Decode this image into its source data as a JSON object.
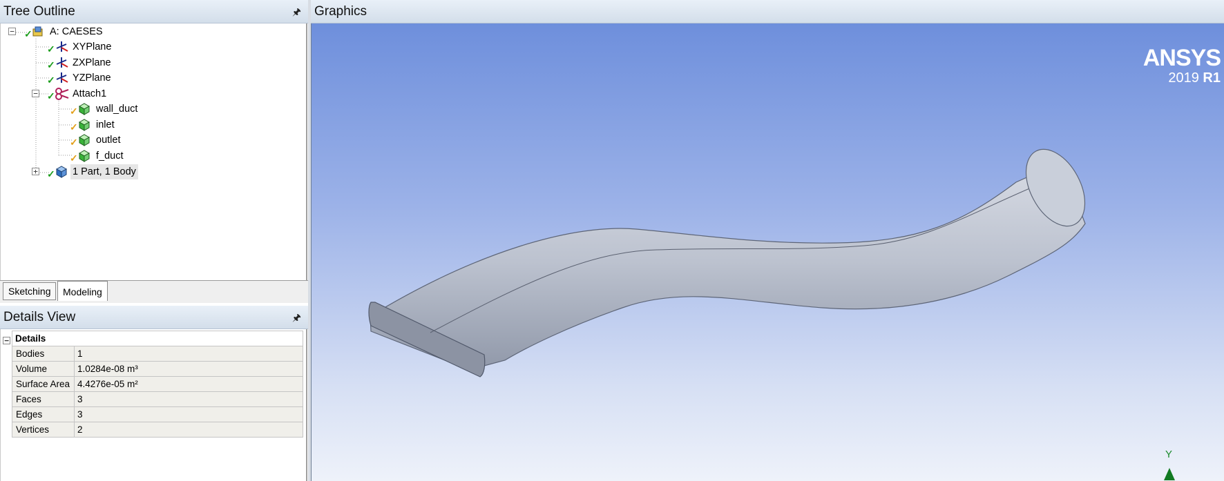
{
  "tree_outline": {
    "title": "Tree Outline",
    "items": [
      {
        "label": "A: CAESES",
        "icon": "geometry-root-icon"
      },
      {
        "label": "XYPlane",
        "icon": "plane-icon"
      },
      {
        "label": "ZXPlane",
        "icon": "plane-icon"
      },
      {
        "label": "YZPlane",
        "icon": "plane-icon"
      },
      {
        "label": "Attach1",
        "icon": "attach-icon"
      },
      {
        "label": "wall_duct",
        "icon": "named-selection-icon"
      },
      {
        "label": "inlet",
        "icon": "named-selection-icon"
      },
      {
        "label": "outlet",
        "icon": "named-selection-icon"
      },
      {
        "label": "f_duct",
        "icon": "named-selection-icon"
      },
      {
        "label": "1 Part, 1 Body",
        "icon": "part-body-icon"
      }
    ]
  },
  "tabs": [
    {
      "label": "Sketching"
    },
    {
      "label": "Modeling"
    }
  ],
  "details_view": {
    "title": "Details View",
    "group": "Details",
    "rows": [
      {
        "key": "Bodies",
        "value": "1"
      },
      {
        "key": "Volume",
        "value": "1.0284e-08 m³"
      },
      {
        "key": "Surface Area",
        "value": "4.4276e-05 m²"
      },
      {
        "key": "Faces",
        "value": "3"
      },
      {
        "key": "Edges",
        "value": "3"
      },
      {
        "key": "Vertices",
        "value": "2"
      }
    ]
  },
  "graphics": {
    "title": "Graphics",
    "brand_name": "ANSYS",
    "brand_year": "2019",
    "brand_release": "R1",
    "axis_label": "Y",
    "colors": {
      "check": "#1a9c1a",
      "duct": "#b9bfcc",
      "axis": "#127a22"
    }
  }
}
